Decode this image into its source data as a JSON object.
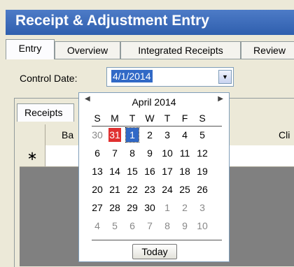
{
  "window": {
    "title": "Receipt & Adjustment Entry"
  },
  "tabs": [
    {
      "label": "Entry"
    },
    {
      "label": "Overview"
    },
    {
      "label": "Integrated Receipts"
    },
    {
      "label": "Review"
    }
  ],
  "control_date": {
    "label": "Control Date:",
    "value": "4/1/2014"
  },
  "subtabs": [
    {
      "label": "Receipts"
    }
  ],
  "grid": {
    "headers": [
      "Ba",
      "Cli"
    ],
    "new_row_marker": "∗"
  },
  "calendar": {
    "month_label": "April 2014",
    "prev_glyph": "◀",
    "next_glyph": "▶",
    "weekdays": [
      "S",
      "M",
      "T",
      "W",
      "T",
      "F",
      "S"
    ],
    "weeks": [
      [
        "30",
        "31",
        "1",
        "2",
        "3",
        "4",
        "5"
      ],
      [
        "6",
        "7",
        "8",
        "9",
        "10",
        "11",
        "12"
      ],
      [
        "13",
        "14",
        "15",
        "16",
        "17",
        "18",
        "19"
      ],
      [
        "20",
        "21",
        "22",
        "23",
        "24",
        "25",
        "26"
      ],
      [
        "27",
        "28",
        "29",
        "30",
        "1",
        "2",
        "3"
      ],
      [
        "4",
        "5",
        "6",
        "7",
        "8",
        "9",
        "10"
      ]
    ],
    "today_button": "Today"
  }
}
